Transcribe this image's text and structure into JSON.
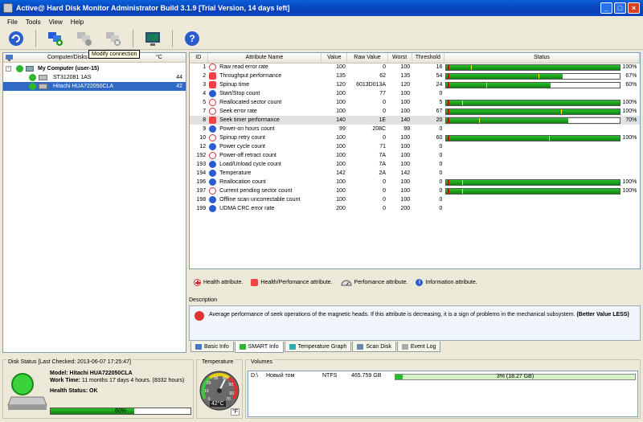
{
  "window": {
    "title": "Active@ Hard Disk Monitor Administrator Build 3.1.9 [Trial Version, 14 days left]"
  },
  "menu": [
    "File",
    "Tools",
    "View",
    "Help"
  ],
  "toolbar": {
    "tooltip": "Modify connection",
    "buttons": [
      "refresh-icon",
      "add-connection-icon",
      "modify-connection-icon",
      "remove-connection-icon",
      "monitor-icon",
      "help-icon"
    ]
  },
  "left": {
    "col_disks": "Computer/Disks",
    "col_temp": "°C",
    "computer": "My Computer (user-15)",
    "disks": [
      {
        "name": "ST312081 1AS",
        "temp": "44"
      },
      {
        "name": "Hitachi HUA722050CLA",
        "temp": "42"
      }
    ]
  },
  "smart": {
    "headers": {
      "id": "ID",
      "name": "Attribute Name",
      "value": "Value",
      "raw": "Raw Value",
      "worst": "Worst",
      "threshold": "Threshold",
      "status": "Status"
    },
    "rows": [
      {
        "id": "1",
        "type": "health",
        "name": "Raw read error rate",
        "value": "100",
        "raw": "0",
        "worst": "100",
        "thr": "16",
        "bar": 100,
        "pct": "100%",
        "yel": 14
      },
      {
        "id": "2",
        "type": "healthperf",
        "name": "Throughput performance",
        "value": "135",
        "raw": "62",
        "worst": "135",
        "thr": "54",
        "bar": 67,
        "pct": "67%",
        "yel": 53
      },
      {
        "id": "3",
        "type": "healthperf",
        "name": "Spinup time",
        "value": "120",
        "raw": "6013D013A",
        "worst": "120",
        "thr": "24",
        "bar": 60,
        "pct": "60%",
        "yel": 23
      },
      {
        "id": "4",
        "type": "info",
        "name": "Start/Stop count",
        "value": "100",
        "raw": "77",
        "worst": "100",
        "thr": "0",
        "bar": null,
        "pct": "",
        "yel": null
      },
      {
        "id": "5",
        "type": "health",
        "name": "Reallocated sector count",
        "value": "100",
        "raw": "0",
        "worst": "100",
        "thr": "5",
        "bar": 100,
        "pct": "100%",
        "yel": 9
      },
      {
        "id": "7",
        "type": "health",
        "name": "Seek error rate",
        "value": "100",
        "raw": "0",
        "worst": "100",
        "thr": "67",
        "bar": 100,
        "pct": "100%",
        "yel": 66
      },
      {
        "id": "8",
        "type": "healthperf",
        "name": "Seek timer performance",
        "value": "140",
        "raw": "1E",
        "worst": "140",
        "thr": "20",
        "bar": 70,
        "pct": "70%",
        "yel": 19
      },
      {
        "id": "9",
        "type": "info",
        "name": "Power-on hours count",
        "value": "99",
        "raw": "208C",
        "worst": "99",
        "thr": "0",
        "bar": null,
        "pct": "",
        "yel": null
      },
      {
        "id": "10",
        "type": "health",
        "name": "Spinup retry count",
        "value": "100",
        "raw": "0",
        "worst": "100",
        "thr": "60",
        "bar": 100,
        "pct": "100%",
        "yel": 59
      },
      {
        "id": "12",
        "type": "info",
        "name": "Power cycle count",
        "value": "100",
        "raw": "71",
        "worst": "100",
        "thr": "0",
        "bar": null,
        "pct": "",
        "yel": null
      },
      {
        "id": "192",
        "type": "health",
        "name": "Power-off retract count",
        "value": "100",
        "raw": "7A",
        "worst": "100",
        "thr": "0",
        "bar": null,
        "pct": "",
        "yel": null
      },
      {
        "id": "193",
        "type": "info",
        "name": "Load/Unload cycle count",
        "value": "100",
        "raw": "7A",
        "worst": "100",
        "thr": "0",
        "bar": null,
        "pct": "",
        "yel": null
      },
      {
        "id": "194",
        "type": "info",
        "name": "Temperature",
        "value": "142",
        "raw": "2A",
        "worst": "142",
        "thr": "0",
        "bar": null,
        "pct": "",
        "yel": null
      },
      {
        "id": "196",
        "type": "info",
        "name": "Reallocation count",
        "value": "100",
        "raw": "0",
        "worst": "100",
        "thr": "0",
        "bar": 100,
        "pct": "100%",
        "yel": 9
      },
      {
        "id": "197",
        "type": "health",
        "name": "Current pending sector count",
        "value": "100",
        "raw": "0",
        "worst": "100",
        "thr": "0",
        "bar": 100,
        "pct": "100%",
        "yel": 9
      },
      {
        "id": "198",
        "type": "info",
        "name": "Offline scan uncorrectable count",
        "value": "100",
        "raw": "0",
        "worst": "100",
        "thr": "0",
        "bar": null,
        "pct": "",
        "yel": null
      },
      {
        "id": "199",
        "type": "info",
        "name": "UDMA CRC error rate",
        "value": "200",
        "raw": "0",
        "worst": "200",
        "thr": "0",
        "bar": null,
        "pct": "",
        "yel": null
      }
    ]
  },
  "legend": {
    "health": "Health attribute.",
    "healthperf": "Health/Perfomance attribute.",
    "perf": "Perfomance attribute.",
    "info": "Information attribute."
  },
  "description": {
    "label": "Description",
    "text": "Average performance of seek operations of the magnetic heads. If this attribute is decreasing, it is a sign of problems in the mechanical subsystem.",
    "emph": "(Better Value LESS)"
  },
  "tabs": [
    "Basic Info",
    "SMART Info",
    "Temperature Graph",
    "Scan Disk",
    "Event Log"
  ],
  "disk_status": {
    "label": "Disk Status [Last Checked: 2013-06-07 17:25:47]",
    "model_label": "Model:",
    "model": "Hitachi HUA722050CLA",
    "worktime_label": "Work Time:",
    "worktime": "11 months 17 days 4 hours. (8332 hours)",
    "health_label": "Health Status:",
    "health": "OK",
    "health_pct": "60%",
    "health_frac": 0.6
  },
  "temperature": {
    "label": "Temperature",
    "value": "42°C",
    "unit": "°F",
    "gauge": [
      "0",
      "10",
      "20",
      "30",
      "40",
      "50",
      "60",
      "70"
    ]
  },
  "volumes": {
    "label": "Volumes",
    "rows": [
      {
        "drive": "D:\\",
        "name": "Новый том",
        "fs": "NTFS",
        "size": "465.759 GB",
        "usage": "3% (18.27 GB)",
        "frac": 0.03
      }
    ]
  }
}
